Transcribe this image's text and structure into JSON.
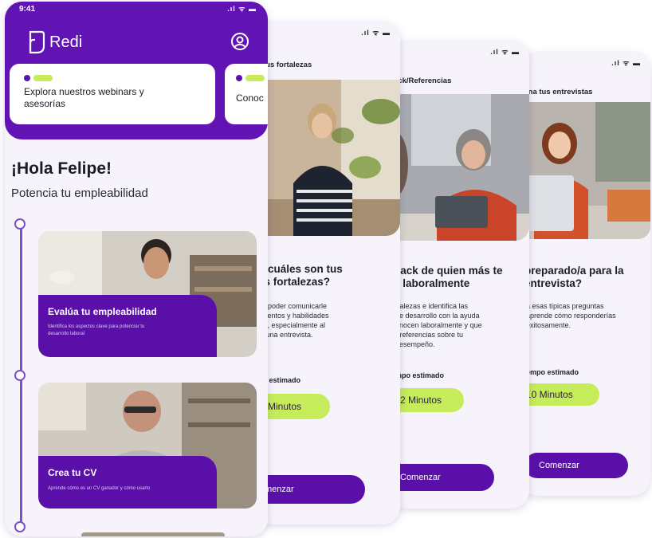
{
  "colors": {
    "brand": "#6113b4",
    "accent": "#c6ec5c",
    "background": "#f6f3fb",
    "cta": "#5a10a8"
  },
  "main": {
    "status_time": "9:41",
    "status_icons": "signal-wifi-battery",
    "logo_text": "Redi",
    "logo_icon": "redi-logo-icon",
    "profile_icon": "user-circle-icon",
    "cards": [
      {
        "text": "Explora nuestros webinars y\nasesorías"
      },
      {
        "text": "Conoc"
      }
    ],
    "greeting": "¡Hola Felipe!",
    "subtitle": "Potencia tu empleabilidad",
    "features": [
      {
        "title": "Evalúa tu empleabilidad",
        "description": "Identifica los aspectos clave para potenciar tu\ndesarrollo laboral"
      },
      {
        "title": "Crea tu CV",
        "description": "Aprende cómo es un CV ganador y cómo usarlo"
      }
    ]
  },
  "screens": [
    {
      "title": "tus fortalezas",
      "question": "o cuáles son tus\nes fortalezas?",
      "body": "te poder comunicarle\ntalentos y habilidades\nas, especialmente al\ne una entrevista.",
      "time_label": "po estimado",
      "time_value": "0 Minutos",
      "cta": "menzar"
    },
    {
      "title": "ack/Referencias",
      "question": "back de quien más te\ne laboralmente",
      "body": "rtalezas e identifica las\nde desarrollo con la ayuda\nonocen laboralmente y que\nr referencias sobre tu\ndesempeño.",
      "time_label": "mpo estimado",
      "time_value": "2 Minutos",
      "cta": "Comenzar"
    },
    {
      "title": "ina tus entrevistas",
      "question": "preparado/a para la\nentrevista?",
      "body": "a esas típicas preguntas\naprende cómo responderías\nexitosamente.",
      "time_label": "empo estimado",
      "time_value": "10 Minutos",
      "cta": "Comenzar"
    }
  ]
}
